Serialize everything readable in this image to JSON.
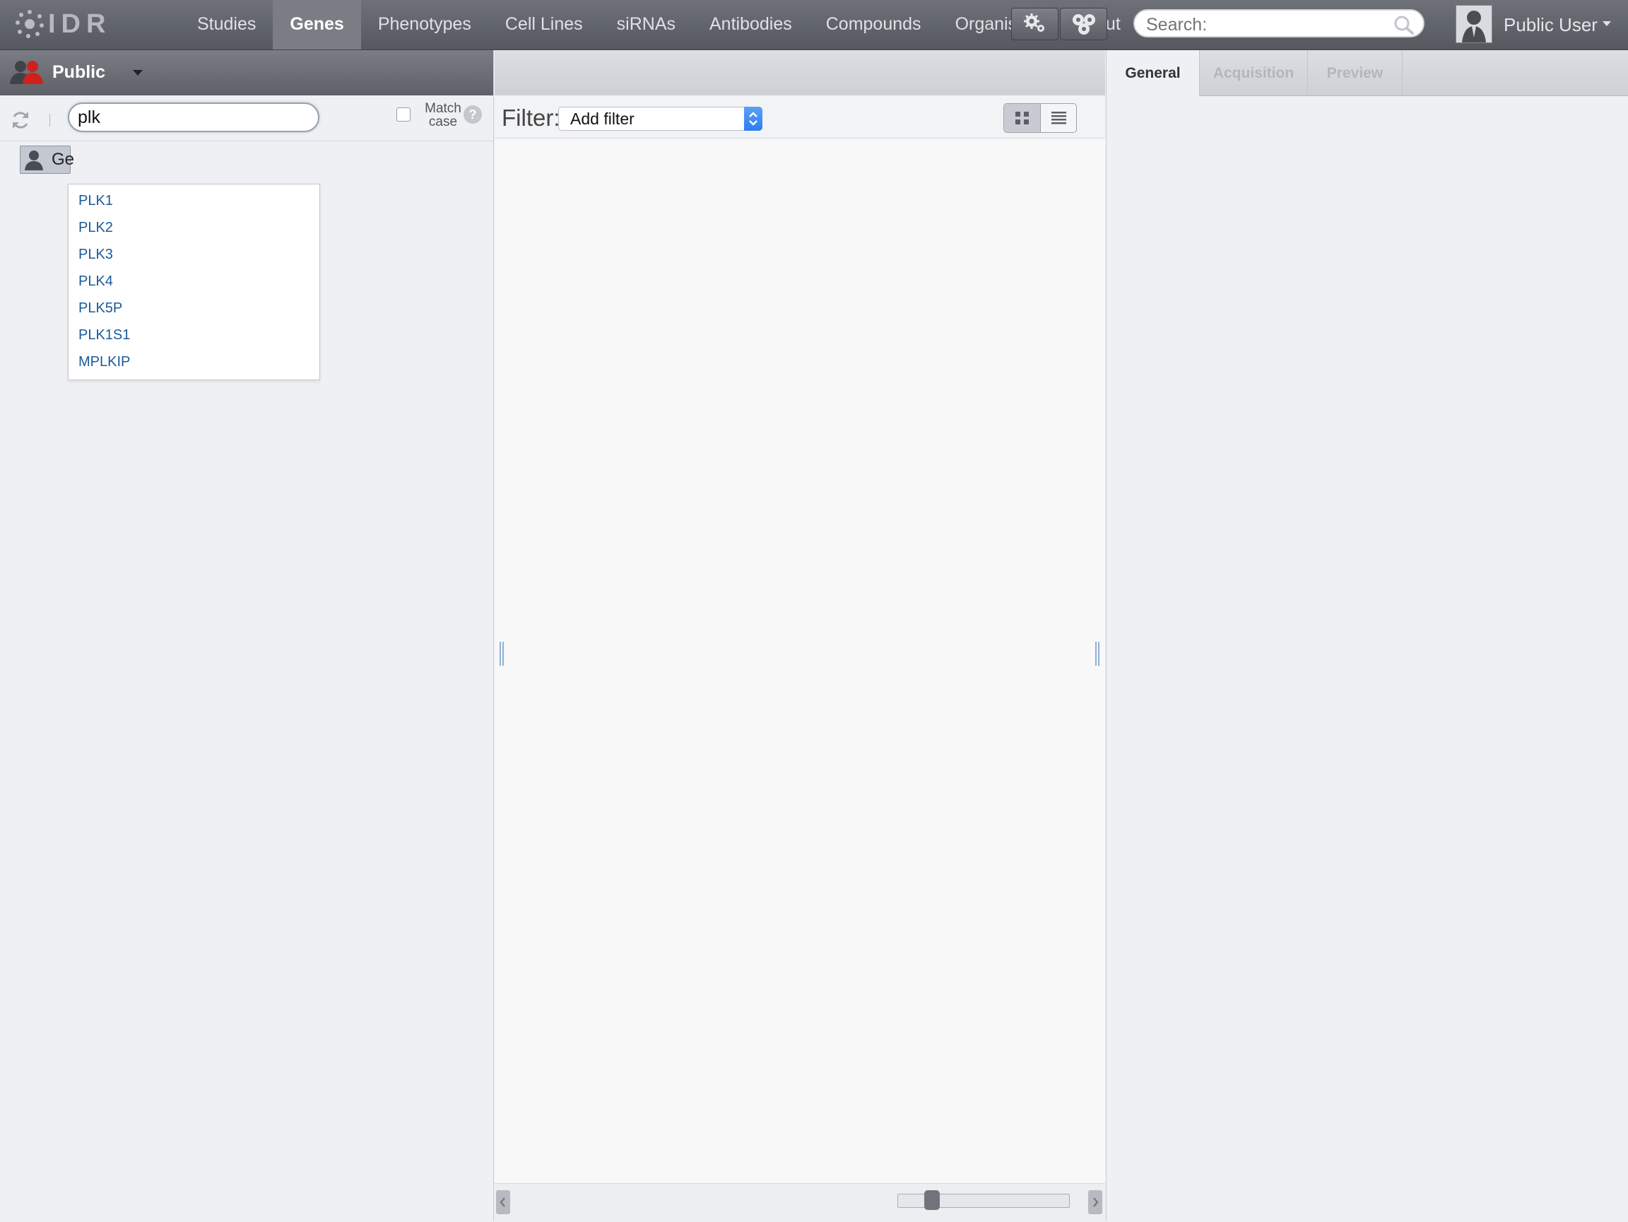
{
  "app": {
    "logo_text": "IDR"
  },
  "nav": {
    "items": [
      {
        "label": "Studies",
        "active": false
      },
      {
        "label": "Genes",
        "active": true
      },
      {
        "label": "Phenotypes",
        "active": false
      },
      {
        "label": "Cell Lines",
        "active": false
      },
      {
        "label": "siRNAs",
        "active": false
      },
      {
        "label": "Antibodies",
        "active": false
      },
      {
        "label": "Compounds",
        "active": false
      },
      {
        "label": "Organisms",
        "active": false
      },
      {
        "label": "About",
        "active": false
      }
    ]
  },
  "header": {
    "search_placeholder": "Search:",
    "user_name": "Public User",
    "tool_icons": [
      "settings-gear-icon",
      "scripts-icon"
    ]
  },
  "left": {
    "group_label": "Public",
    "search_value": "plk",
    "match_case_label": "Match case",
    "match_case_checked": false,
    "help_label": "?",
    "tree_node_label": "Ge",
    "autocomplete": [
      "PLK1",
      "PLK2",
      "PLK3",
      "PLK4",
      "PLK5P",
      "PLK1S1",
      "MPLKIP"
    ]
  },
  "center": {
    "filter_label": "Filter:",
    "filter_value": "Add filter",
    "view_mode": "thumbnails"
  },
  "right": {
    "tabs": [
      {
        "label": "General",
        "active": true
      },
      {
        "label": "Acquisition",
        "active": false
      },
      {
        "label": "Preview",
        "active": false
      }
    ]
  },
  "colors": {
    "topbar": "#5f6269",
    "active_nav": "#7a7d84",
    "link": "#1a5a99",
    "select_arrow": "#2f7ef0",
    "group_icon_red": "#d0201c"
  }
}
